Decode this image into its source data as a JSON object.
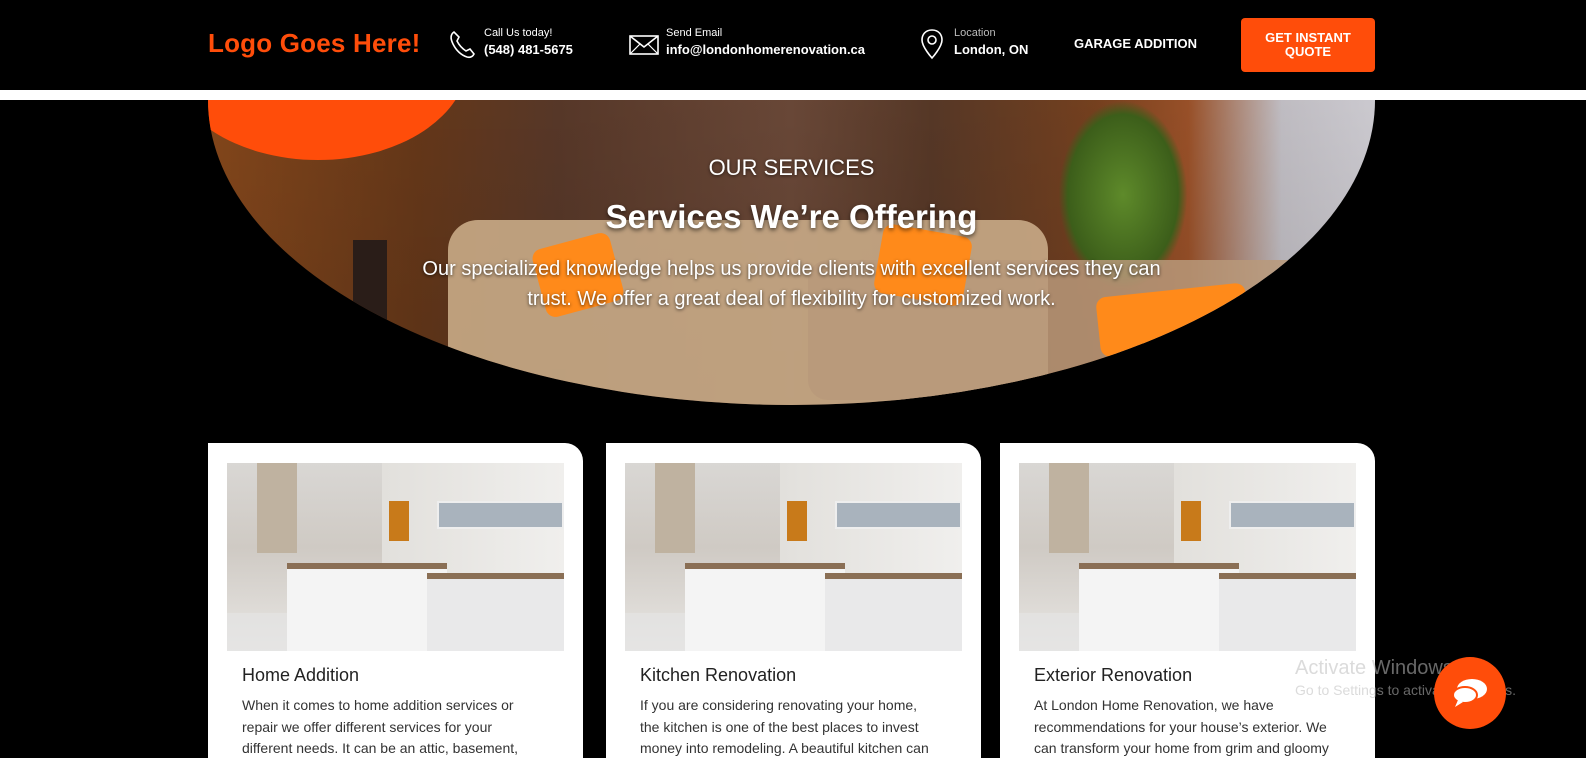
{
  "header": {
    "logo": "Logo Goes Here!",
    "phone": {
      "label": "Call Us today!",
      "value": "(548) 481-5675",
      "icon": "phone-icon"
    },
    "email": {
      "label": "Send Email",
      "value": "info@londonhomerenovation.ca",
      "icon": "mail-icon"
    },
    "location": {
      "label": "Location",
      "value": "London, ON",
      "icon": "location-pin-icon"
    },
    "nav_link": "GARAGE ADDITION",
    "cta": "GET INSTANT QUOTE"
  },
  "hero": {
    "eyebrow": "OUR SERVICES",
    "title": "Services We’re Offering",
    "description": "Our specialized knowledge helps us provide clients with excellent services they can trust. We offer a great deal of flexibility for customized work."
  },
  "cards": [
    {
      "title": "Home Addition",
      "text": "When it comes to home addition services or repair we offer different services for your different needs. It can be an attic, basement,"
    },
    {
      "title": "Kitchen Renovation",
      "text": "If you are considering renovating your home, the kitchen is one of the best places to invest money into remodeling. A beautiful kitchen can"
    },
    {
      "title": "Exterior Renovation",
      "text": "At London Home Renovation, we have recommendations for your house’s exterior. We can transform your home from grim and gloomy"
    }
  ],
  "watermark": {
    "line1": "Activate Windows",
    "line2": "Go to Settings to activate Windows."
  },
  "colors": {
    "accent": "#ff4d0a",
    "background": "#000000"
  }
}
